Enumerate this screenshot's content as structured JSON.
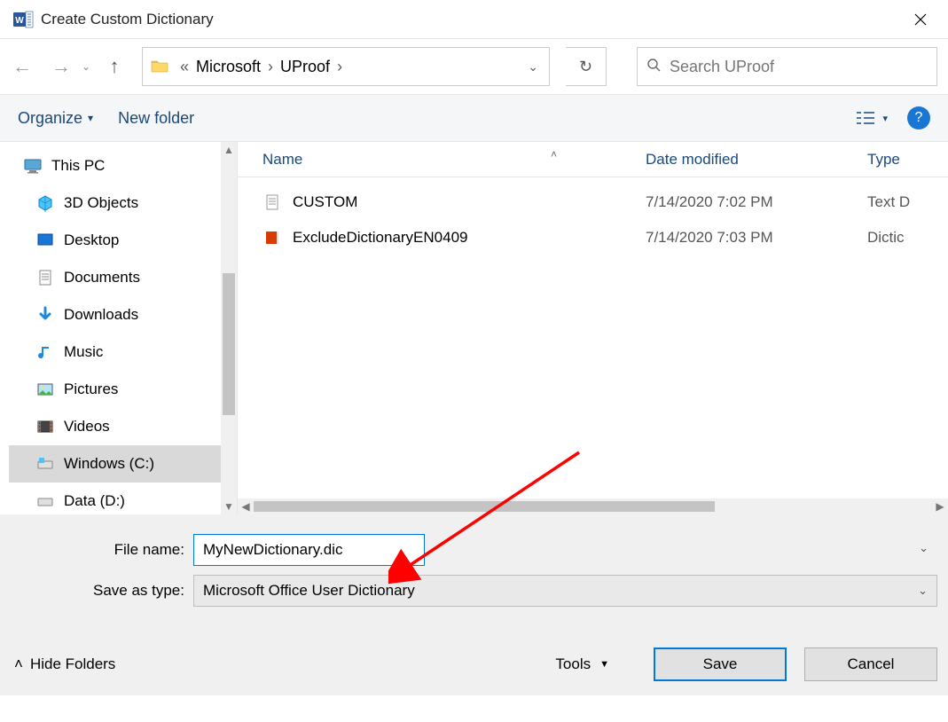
{
  "window": {
    "title": "Create Custom Dictionary"
  },
  "path": {
    "sep1": "«",
    "crumb1": "Microsoft",
    "crumb2": "UProof"
  },
  "search": {
    "placeholder": "Search UProof"
  },
  "toolbar": {
    "organize": "Organize",
    "newfolder": "New folder"
  },
  "tree": {
    "root": "This PC",
    "items": [
      {
        "label": "3D Objects"
      },
      {
        "label": "Desktop"
      },
      {
        "label": "Documents"
      },
      {
        "label": "Downloads"
      },
      {
        "label": "Music"
      },
      {
        "label": "Pictures"
      },
      {
        "label": "Videos"
      },
      {
        "label": "Windows (C:)"
      },
      {
        "label": "Data (D:)"
      }
    ]
  },
  "columns": {
    "name": "Name",
    "date": "Date modified",
    "type": "Type"
  },
  "files": [
    {
      "name": "CUSTOM",
      "date": "7/14/2020 7:02 PM",
      "type": "Text D"
    },
    {
      "name": "ExcludeDictionaryEN0409",
      "date": "7/14/2020 7:03 PM",
      "type": "Dictic"
    }
  ],
  "form": {
    "filename_label": "File name:",
    "filename_value": "MyNewDictionary.dic",
    "saveas_label": "Save as type:",
    "saveas_value": "Microsoft Office User Dictionary"
  },
  "actions": {
    "hide_folders": "Hide Folders",
    "tools": "Tools",
    "save": "Save",
    "cancel": "Cancel"
  }
}
